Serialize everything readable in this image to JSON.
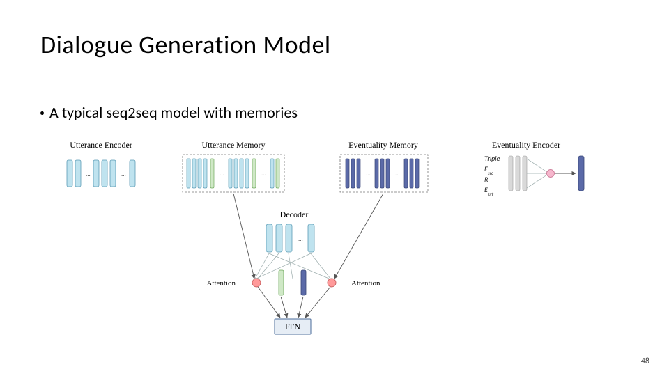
{
  "title": "Dialogue Generation Model",
  "bullet": "A typical seq2seq model with memories",
  "slideNumber": "48",
  "diagram": {
    "components": {
      "utteranceEncoder": "Utterance Encoder",
      "utteranceMemory": "Utterance Memory",
      "eventualityMemory": "Eventuality Memory",
      "eventualityEncoder": "Eventuality Encoder",
      "decoder": "Decoder",
      "attentionLeft": "Attention",
      "attentionRight": "Attention",
      "ffn": "FFN",
      "encoderSideLabels": [
        "Triple",
        "E",
        "R",
        "E"
      ],
      "encoderSideSubscripts": [
        "",
        "src",
        "",
        "tgt"
      ]
    }
  }
}
